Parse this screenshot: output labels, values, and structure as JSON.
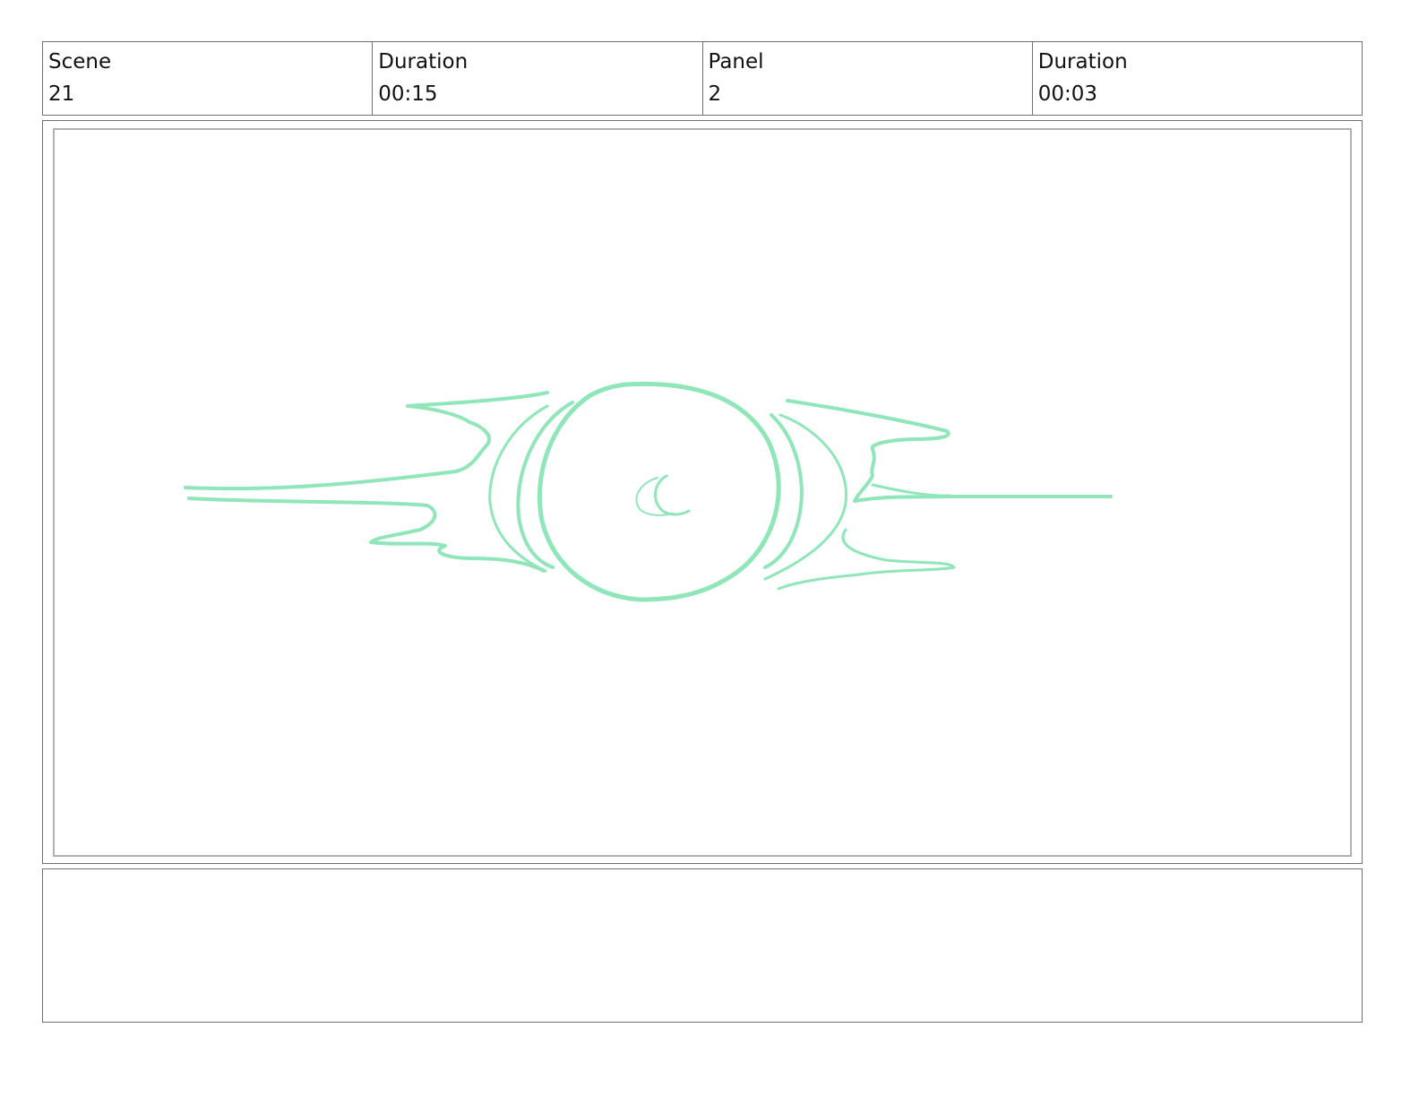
{
  "header": {
    "scene_label": "Scene",
    "scene_value": "21",
    "scene_duration_label": "Duration",
    "scene_duration_value": "00:15",
    "panel_label": "Panel",
    "panel_value": "2",
    "panel_duration_label": "Duration",
    "panel_duration_value": "00:03"
  },
  "sketch": {
    "stroke_color": "#8fe6b8",
    "subject": "eye-sketch-icon"
  },
  "notes": {
    "text": ""
  }
}
